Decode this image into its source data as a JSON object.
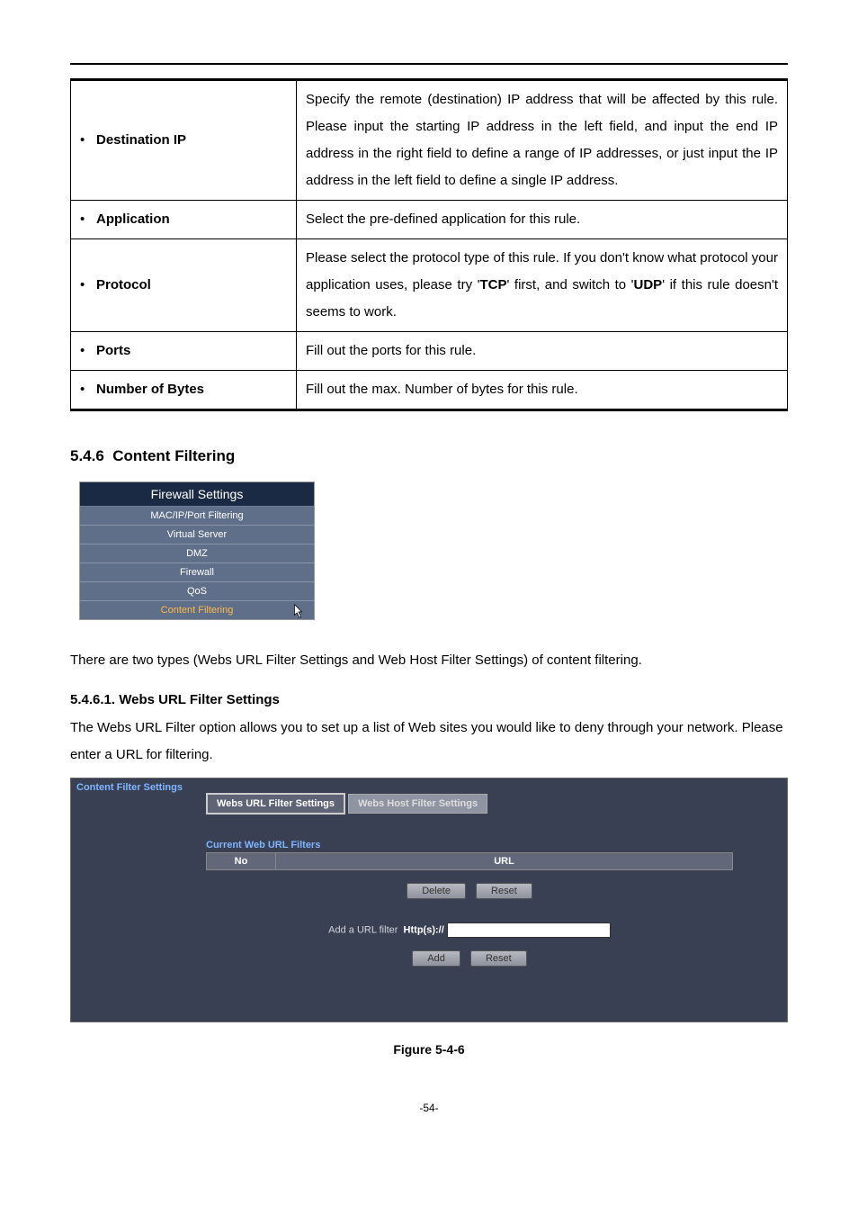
{
  "defs": [
    {
      "key": "Destination IP",
      "val": "Specify the remote (destination) IP address that will be affected by this rule. Please input the starting IP address in the left field, and input the end IP address in the right field to define a range of IP addresses, or just input the IP address in the left field to define a single IP address."
    },
    {
      "key": "Application",
      "val": "Select the pre-defined application for this rule."
    },
    {
      "key": "Protocol",
      "val_pre": "Please select the protocol type of this rule. If you don't know what protocol your application uses, please try '",
      "val_mid1": "TCP",
      "val_mid2": "' first, and switch to '",
      "val_mid3": "UDP",
      "val_post": "' if this rule doesn't seems to work."
    },
    {
      "key": "Ports",
      "val": "Fill out the ports for this rule."
    },
    {
      "key": "Number of Bytes",
      "val": "Fill out the max. Number of bytes for this rule."
    }
  ],
  "section_num": "5.4.6",
  "section_title": "Content Filtering",
  "sidebar": {
    "head": "Firewall Settings",
    "items": [
      "MAC/IP/Port Filtering",
      "Virtual Server",
      "DMZ",
      "Firewall",
      "QoS",
      "Content Filtering"
    ]
  },
  "para1": "There are two types (Webs URL Filter Settings and Web Host Filter Settings) of content filtering.",
  "sub_num": "5.4.6.1.",
  "sub_title": "Webs URL Filter Settings",
  "para2": "The Webs URL Filter option allows you to set up a list of Web sites you would like to deny through your network. Please enter a URL for filtering.",
  "panel": {
    "sidebar_title": "Content Filter Settings",
    "tab_active": "Webs URL Filter Settings",
    "tab_inactive": "Webs Host Filter Settings",
    "table_title": "Current Web URL Filters",
    "col_no": "No",
    "col_url": "URL",
    "btn_delete": "Delete",
    "btn_reset": "Reset",
    "add_label": "Add a URL filter",
    "add_prefix": "Http(s)://",
    "btn_add": "Add"
  },
  "fig": "Figure 5-4-6",
  "pagenum": "-54-"
}
